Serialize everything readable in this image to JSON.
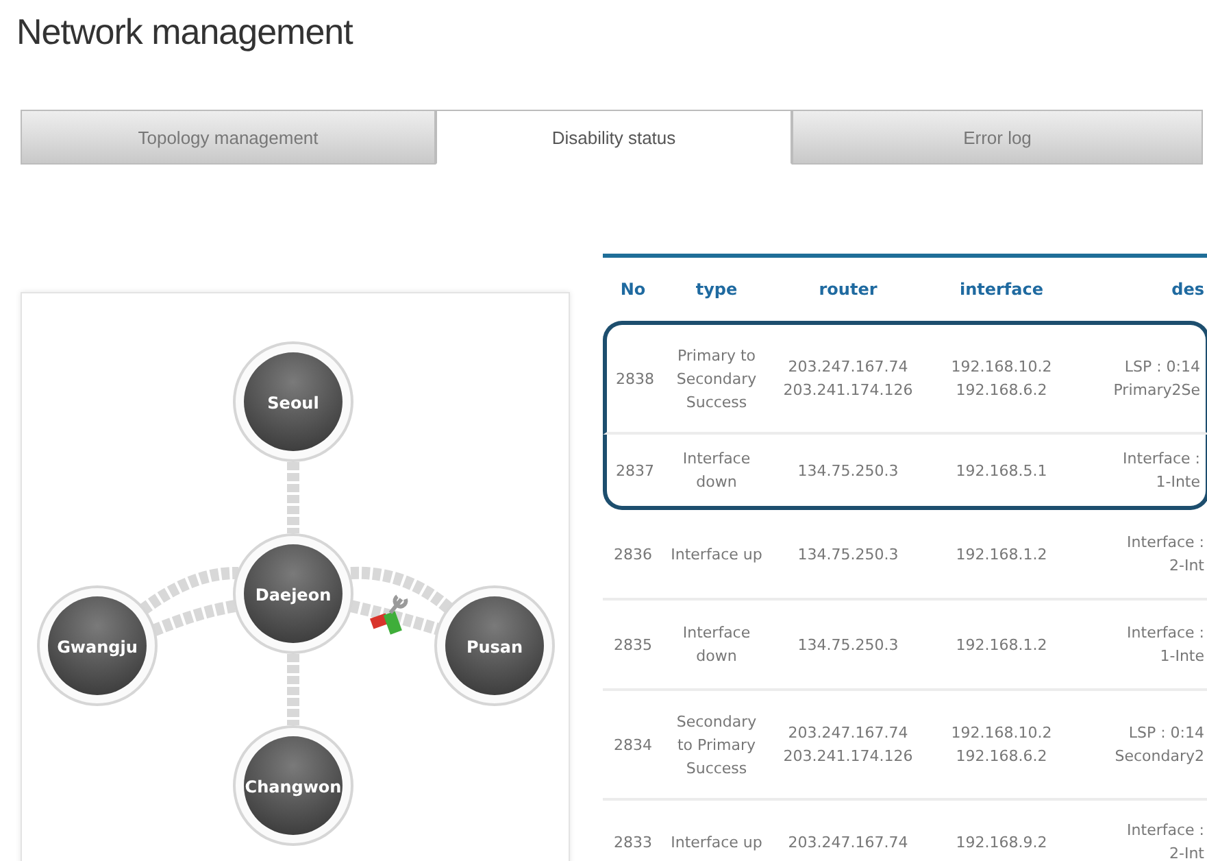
{
  "title": "Network management",
  "tabs": [
    {
      "label": "Topology management",
      "selected": false
    },
    {
      "label": "Disability status",
      "selected": true
    },
    {
      "label": "Error log",
      "selected": false
    }
  ],
  "topology": {
    "nodes": [
      {
        "label": "Seoul",
        "fault": false
      },
      {
        "label": "Daejeon",
        "fault": false
      },
      {
        "label": "Gwangju",
        "fault": false
      },
      {
        "label": "Pusan",
        "fault": true
      },
      {
        "label": "Changwon",
        "fault": false
      }
    ]
  },
  "table": {
    "columns": [
      "No",
      "type",
      "router",
      "interface",
      "des"
    ],
    "rows": [
      {
        "cells": [
          "2838",
          "Primary to\nSecondary\nSuccess",
          "203.247.167.74\n203.241.174.126",
          "192.168.10.2\n192.168.6.2",
          "LSP : 0:14\nPrimary2Se"
        ],
        "selected": true
      },
      {
        "cells": [
          "2837",
          "Interface\ndown",
          "134.75.250.3",
          "192.168.5.1",
          "Interface :\n1-Inte"
        ],
        "selected": true
      },
      {
        "cells": [
          "2836",
          "Interface up",
          "134.75.250.3",
          "192.168.1.2",
          "Interface :\n2-Int"
        ],
        "selected": false
      },
      {
        "cells": [
          "2835",
          "Interface\ndown",
          "134.75.250.3",
          "192.168.1.2",
          "Interface :\n1-Inte"
        ],
        "selected": false
      },
      {
        "cells": [
          "2834",
          "Secondary\nto Primary\nSuccess",
          "203.247.167.74\n203.241.174.126",
          "192.168.10.2\n192.168.6.2",
          "LSP : 0:14\nSecondary2"
        ],
        "selected": false
      },
      {
        "cells": [
          "2833",
          "Interface up",
          "203.247.167.74",
          "192.168.9.2",
          "Interface :\n2-Int"
        ],
        "selected": false
      }
    ]
  }
}
